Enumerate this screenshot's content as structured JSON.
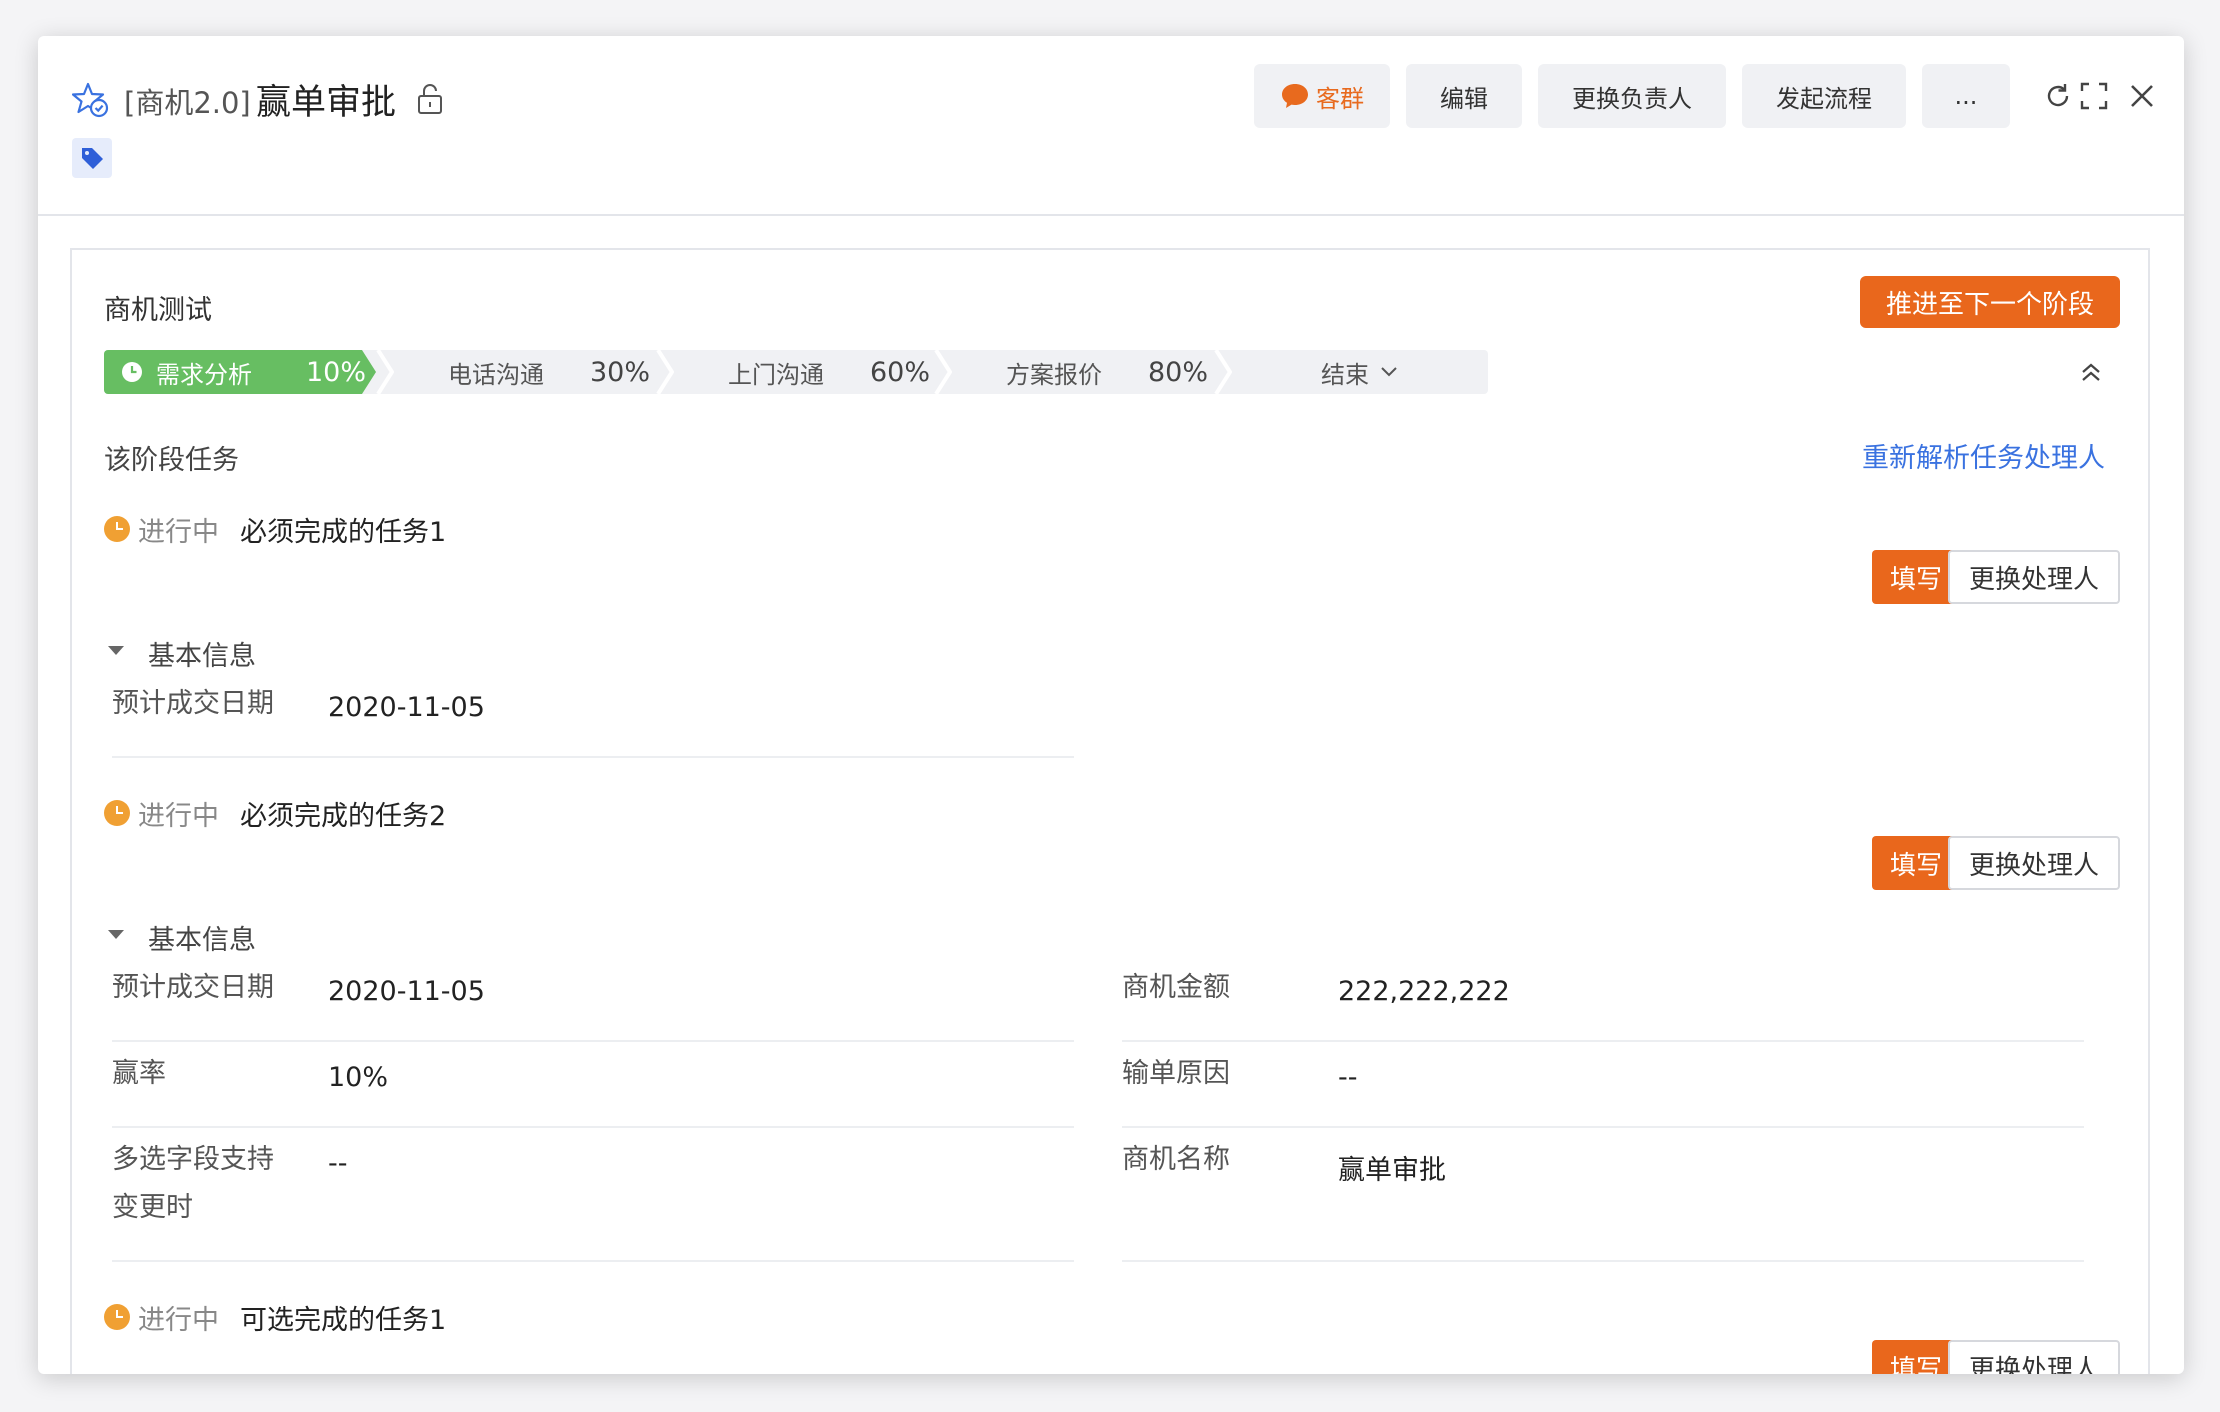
{
  "header": {
    "title_prefix": "[商机2.0]",
    "title": "赢单审批",
    "buttons": {
      "kequn": "客群",
      "edit": "编辑",
      "change_owner": "更换负责人",
      "start_flow": "发起流程",
      "more": "..."
    }
  },
  "card": {
    "title": "商机测试",
    "advance_button": "推进至下一个阶段",
    "stages": [
      {
        "label": "需求分析",
        "percent": "10%"
      },
      {
        "label": "电话沟通",
        "percent": "30%"
      },
      {
        "label": "上门沟通",
        "percent": "60%"
      },
      {
        "label": "方案报价",
        "percent": "80%"
      },
      {
        "label": "结束",
        "percent": ""
      }
    ],
    "active_stage": 0,
    "section_title": "该阶段任务",
    "reparse_link": "重新解析任务处理人"
  },
  "tasks": [
    {
      "status": "进行中",
      "name": "必须完成的任务1",
      "fill": "填写",
      "change": "更换处理人",
      "group": "基本信息",
      "fields": [
        {
          "label": "预计成交日期",
          "value": "2020-11-05"
        }
      ]
    },
    {
      "status": "进行中",
      "name": "必须完成的任务2",
      "fill": "填写",
      "change": "更换处理人",
      "group": "基本信息",
      "fields": [
        {
          "label": "预计成交日期",
          "value": "2020-11-05"
        },
        {
          "label": "商机金额",
          "value": "222,222,222"
        },
        {
          "label": "赢率",
          "value": "10%"
        },
        {
          "label": "输单原因",
          "value": "--"
        },
        {
          "label": "多选字段支持变更时",
          "value": "--"
        },
        {
          "label": "商机名称",
          "value": "赢单审批"
        }
      ]
    },
    {
      "status": "进行中",
      "name": "可选完成的任务1",
      "fill": "填写",
      "change": "更换处理人"
    }
  ],
  "colors": {
    "accent_orange": "#e9671c",
    "stage_active_green": "#67be62",
    "link_blue": "#3a72e0",
    "status_orange": "#f0a033"
  }
}
